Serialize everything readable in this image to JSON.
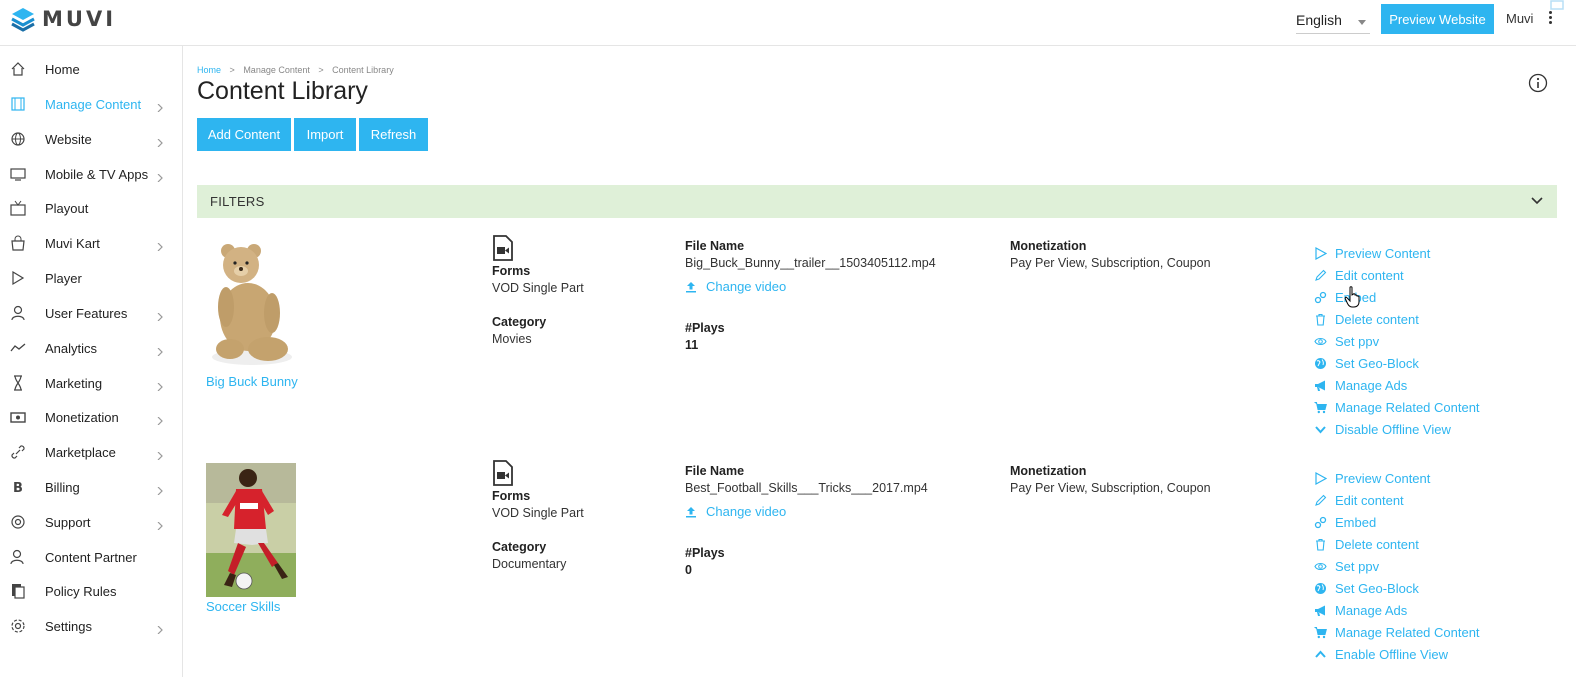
{
  "header": {
    "logo_text": "MUVI",
    "language": "English",
    "preview_button": "Preview Website",
    "user_name": "Muvi"
  },
  "sidebar": {
    "items": [
      {
        "label": "Home",
        "icon": "home-icon",
        "has_submenu": false,
        "active": false
      },
      {
        "label": "Manage Content",
        "icon": "film-icon",
        "has_submenu": true,
        "active": true
      },
      {
        "label": "Website",
        "icon": "globe-icon",
        "has_submenu": true,
        "active": false
      },
      {
        "label": "Mobile & TV Apps",
        "icon": "monitor-icon",
        "has_submenu": true,
        "active": false
      },
      {
        "label": "Playout",
        "icon": "tv-icon",
        "has_submenu": false,
        "active": false
      },
      {
        "label": "Muvi Kart",
        "icon": "shopping-bag-icon",
        "has_submenu": true,
        "active": false
      },
      {
        "label": "Player",
        "icon": "play-icon",
        "has_submenu": false,
        "active": false
      },
      {
        "label": "User Features",
        "icon": "user-icon",
        "has_submenu": true,
        "active": false
      },
      {
        "label": "Analytics",
        "icon": "trend-line-icon",
        "has_submenu": true,
        "active": false
      },
      {
        "label": "Marketing",
        "icon": "hourglass-icon",
        "has_submenu": true,
        "active": false
      },
      {
        "label": "Monetization",
        "icon": "money-icon",
        "has_submenu": true,
        "active": false
      },
      {
        "label": "Marketplace",
        "icon": "link-icon",
        "has_submenu": true,
        "active": false
      },
      {
        "label": "Billing",
        "icon": "bitcoin-icon",
        "has_submenu": true,
        "active": false
      },
      {
        "label": "Support",
        "icon": "lifebuoy-icon",
        "has_submenu": true,
        "active": false
      },
      {
        "label": "Content Partner",
        "icon": "partner-icon",
        "has_submenu": false,
        "active": false
      },
      {
        "label": "Policy Rules",
        "icon": "policy-icon",
        "has_submenu": false,
        "active": false
      },
      {
        "label": "Settings",
        "icon": "gear-icon",
        "has_submenu": true,
        "active": false
      }
    ]
  },
  "breadcrumb": {
    "home": "Home",
    "sep": ">",
    "level1": "Manage Content",
    "level2": "Content Library"
  },
  "page": {
    "title": "Content Library",
    "buttons": {
      "add": "Add Content",
      "import": "Import",
      "refresh": "Refresh"
    },
    "filters_label": "FILTERS"
  },
  "labels": {
    "forms": "Forms",
    "category": "Category",
    "file_name": "File Name",
    "plays": "#Plays",
    "monetization": "Monetization",
    "change_video": "Change video"
  },
  "content_items": [
    {
      "title": "Big Buck Bunny",
      "thumbnail": "teddy-bear",
      "form": "VOD Single Part",
      "category": "Movies",
      "file_name": "Big_Buck_Bunny__trailer__1503405112.mp4",
      "plays": "11",
      "monetization": "Pay Per View, Subscription, Coupon",
      "actions": [
        {
          "label": "Preview Content",
          "icon": "play-outline-icon"
        },
        {
          "label": "Edit content",
          "icon": "pencil-icon"
        },
        {
          "label": "Embed",
          "icon": "link-icon"
        },
        {
          "label": "Delete content",
          "icon": "trash-icon"
        },
        {
          "label": "Set ppv",
          "icon": "eye-icon"
        },
        {
          "label": "Set Geo-Block",
          "icon": "globe-solid-icon"
        },
        {
          "label": "Manage Ads",
          "icon": "megaphone-icon"
        },
        {
          "label": "Manage Related Content",
          "icon": "cart-icon"
        },
        {
          "label": "Disable Offline View",
          "icon": "chevron-down-icon"
        }
      ]
    },
    {
      "title": "Soccer Skills",
      "thumbnail": "soccer-player",
      "form": "VOD Single Part",
      "category": "Documentary",
      "file_name": "Best_Football_Skills___Tricks___2017.mp4",
      "plays": "0",
      "monetization": "Pay Per View, Subscription, Coupon",
      "actions": [
        {
          "label": "Preview Content",
          "icon": "play-outline-icon"
        },
        {
          "label": "Edit content",
          "icon": "pencil-icon"
        },
        {
          "label": "Embed",
          "icon": "link-icon"
        },
        {
          "label": "Delete content",
          "icon": "trash-icon"
        },
        {
          "label": "Set ppv",
          "icon": "eye-icon"
        },
        {
          "label": "Set Geo-Block",
          "icon": "globe-solid-icon"
        },
        {
          "label": "Manage Ads",
          "icon": "megaphone-icon"
        },
        {
          "label": "Manage Related Content",
          "icon": "cart-icon"
        },
        {
          "label": "Enable Offline View",
          "icon": "chevron-up-icon"
        }
      ]
    }
  ],
  "colors": {
    "accent": "#2eb5f0",
    "filters_bg": "#dff0d8",
    "text": "#333333"
  }
}
